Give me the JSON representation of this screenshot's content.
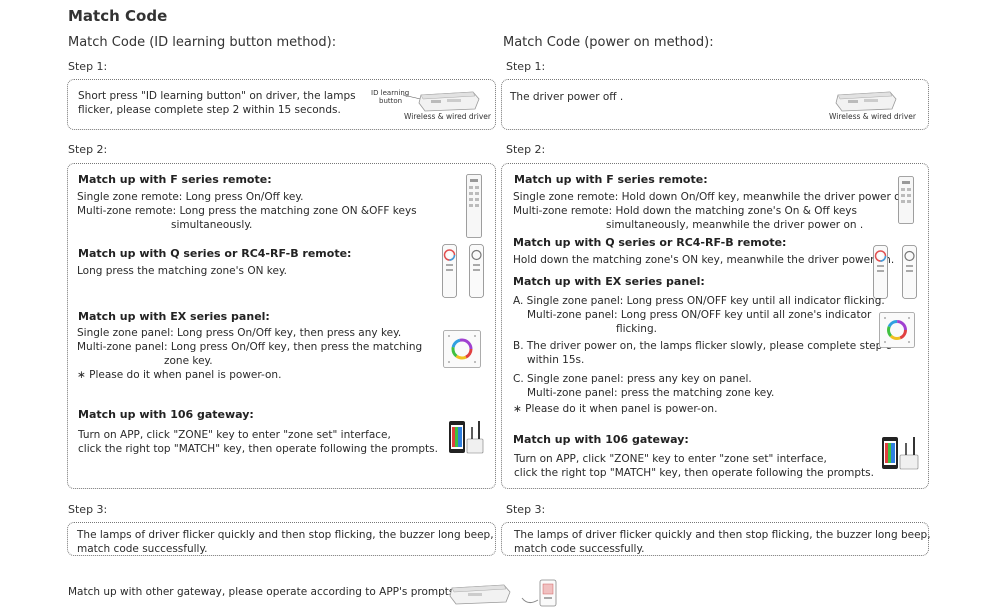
{
  "title": "Match Code",
  "left": {
    "heading": "Match  Code (ID learning button method):",
    "step1": {
      "label": "Step 1:",
      "lines": [
        "Short press \"ID learning button\" on driver, the lamps",
        "flicker, please complete step 2 within 15 seconds."
      ],
      "id_label_1": "ID learning",
      "id_label_2": "button",
      "caption": "Wireless & wired driver"
    },
    "step2": {
      "label": "Step 2:",
      "f_title": "Match up with F series remote:",
      "f_lines": [
        "Single zone remote: Long press On/Off key.",
        "Multi-zone remote: Long press the matching zone ON &OFF keys",
        "simultaneously."
      ],
      "q_title": "Match up with Q series  or RC4-RF-B remote:",
      "q_lines": [
        "Long press the matching zone's ON key."
      ],
      "ex_title": "Match up with EX series panel:",
      "ex_lines": [
        "Single zone panel: Long press On/Off key, then press any key.",
        "Multi-zone panel: Long press On/Off key, then press the matching",
        "zone key.",
        "∗  Please do it when panel is power-on."
      ],
      "gw_title": "Match up with 106 gateway:",
      "gw_lines": [
        "Turn on APP, click \"ZONE\" key to enter \"zone set\" interface,",
        "click the right top \"MATCH\" key, then operate following the prompts."
      ]
    },
    "step3": {
      "label": "Step 3:",
      "lines": [
        "The lamps of driver flicker quickly and then stop flicking, the buzzer long beep,",
        "match code successfully."
      ]
    }
  },
  "right": {
    "heading": "Match  Code (power on method):",
    "step1": {
      "label": "Step 1:",
      "lines": [
        "The driver power off ."
      ],
      "caption": "Wireless & wired driver"
    },
    "step2": {
      "label": "Step 2:",
      "f_title": "Match up with F series remote:",
      "f_lines": [
        "Single zone remote: Hold down On/Off key, meanwhile the driver power on .",
        "Multi-zone remote: Hold down the matching zone's On & Off keys",
        "simultaneously, meanwhile the driver power on ."
      ],
      "q_title": "Match up with Q series  or RC4-RF-B remote:",
      "q_lines": [
        "Hold down the matching zone's ON key, meanwhile the driver power on."
      ],
      "ex_title": "Match up with EX series panel:",
      "ex_lines": [
        "A. Single zone panel: Long press ON/OFF key until all indicator flicking.",
        "Multi-zone panel: Long press ON/OFF key until all zone's indicator",
        "flicking.",
        "B. The driver power on, the lamps flicker slowly, please complete step c",
        "within 15s.",
        "C. Single zone panel: press any key on panel.",
        "Multi-zone panel: press the matching zone key.",
        "∗  Please do it when panel is power-on."
      ],
      "gw_title": "Match up with 106 gateway:",
      "gw_lines": [
        "Turn on APP, click \"ZONE\" key to enter \"zone set\" interface,",
        "click the right top \"MATCH\" key, then operate following the prompts."
      ]
    },
    "step3": {
      "label": "Step 3:",
      "lines": [
        "The lamps of driver flicker quickly and then stop flicking, the buzzer long beep,",
        "match code successfully."
      ]
    }
  },
  "footer": "Match up with other gateway, please operate according to APP's prompts.",
  "icons": [
    "driver-icon",
    "f-series-remote-icon",
    "q-series-remote-icon",
    "ex-series-panel-icon",
    "gateway-106-icon",
    "other-gateway-icon"
  ]
}
